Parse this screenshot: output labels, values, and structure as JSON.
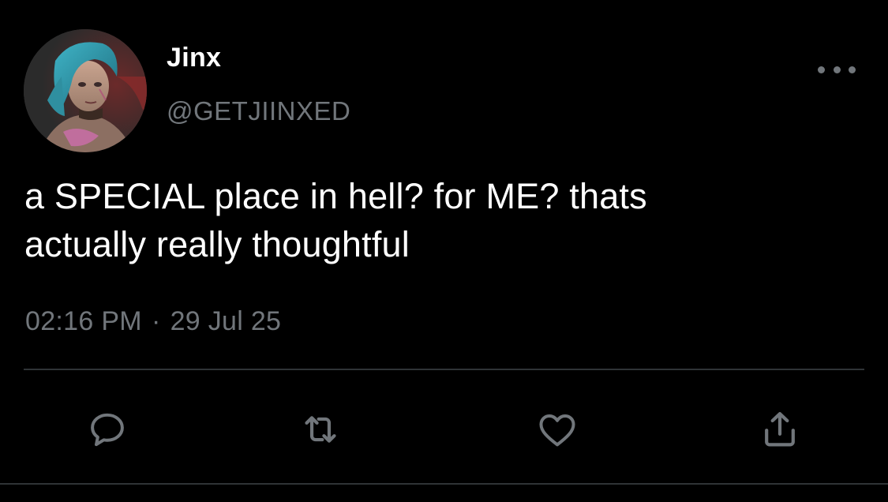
{
  "tweet": {
    "display_name": "Jinx",
    "handle": "@GETJIINXED",
    "text_line1": "a SPECIAL place in hell? for ME? thats",
    "text_line2": "actually really thoughtful",
    "time": "02:16 PM",
    "separator": "·",
    "date": "29 Jul 25"
  },
  "actions": [
    {
      "name": "reply",
      "icon": "speech-bubble-icon"
    },
    {
      "name": "retweet",
      "icon": "retweet-arrows-icon"
    },
    {
      "name": "like",
      "icon": "heart-icon"
    },
    {
      "name": "share",
      "icon": "share-upload-icon"
    }
  ],
  "colors": {
    "background": "#000000",
    "primary_text": "#ffffff",
    "secondary_text": "#71767b",
    "divider": "#2f3336"
  }
}
